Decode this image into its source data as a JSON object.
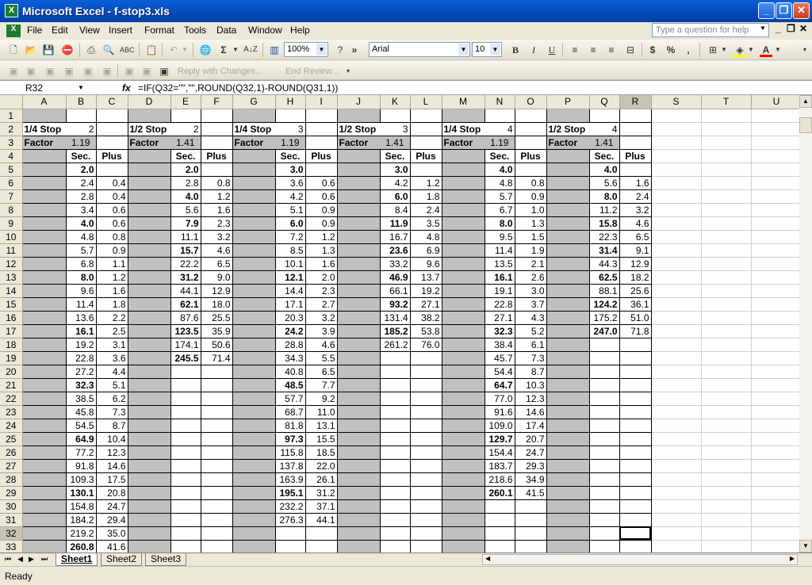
{
  "window": {
    "title": "Microsoft Excel - f-stop3.xls",
    "app_icon": "X",
    "min": "_",
    "restore": "❐",
    "close": "✕"
  },
  "menu": [
    "File",
    "Edit",
    "View",
    "Insert",
    "Format",
    "Tools",
    "Data",
    "Window",
    "Help"
  ],
  "help_placeholder": "Type a question for help",
  "toolbar": {
    "zoom": "100%",
    "font": "Arial",
    "size": "10",
    "bold": "B",
    "italic": "I",
    "underline": "U",
    "reply": "Reply with Changes...",
    "end_review": "End Review..."
  },
  "formula_bar": {
    "name_box": "R32",
    "fx": "fx",
    "formula": "=IF(Q32=\"\",\"\",ROUND(Q32,1)-ROUND(Q31,1))"
  },
  "columns": [
    "A",
    "B",
    "C",
    "D",
    "E",
    "F",
    "G",
    "H",
    "I",
    "J",
    "K",
    "L",
    "M",
    "N",
    "O",
    "P",
    "Q",
    "R",
    "S",
    "T",
    "U"
  ],
  "sheet": {
    "labels": {
      "quarter": "1/4 Stop",
      "half": "1/2 Stop",
      "factor": "Factor",
      "sec": "Sec.",
      "plus": "Plus"
    },
    "groups": [
      {
        "start": "2",
        "factor": "1.19",
        "sec": [
          "2.0",
          "2.4",
          "2.8",
          "3.4",
          "4.0",
          "4.8",
          "5.7",
          "6.8",
          "8.0",
          "9.6",
          "11.4",
          "13.6",
          "16.1",
          "19.2",
          "22.8",
          "27.2",
          "32.3",
          "38.5",
          "45.8",
          "54.5",
          "64.9",
          "77.2",
          "91.8",
          "109.3",
          "130.1",
          "154.8",
          "184.2",
          "219.2",
          "260.8"
        ],
        "plus": [
          "",
          "0.4",
          "0.4",
          "0.6",
          "0.6",
          "0.8",
          "0.9",
          "1.1",
          "1.2",
          "1.6",
          "1.8",
          "2.2",
          "2.5",
          "3.1",
          "3.6",
          "4.4",
          "5.1",
          "6.2",
          "7.3",
          "8.7",
          "10.4",
          "12.3",
          "14.6",
          "17.5",
          "20.8",
          "24.7",
          "29.4",
          "35.0",
          "41.6"
        ]
      },
      {
        "start": "2",
        "factor": "1.41",
        "sec": [
          "2.0",
          "2.8",
          "4.0",
          "5.6",
          "7.9",
          "11.1",
          "15.7",
          "22.2",
          "31.2",
          "44.1",
          "62.1",
          "87.6",
          "123.5",
          "174.1",
          "245.5"
        ],
        "plus": [
          "",
          "0.8",
          "1.2",
          "1.6",
          "2.3",
          "3.2",
          "4.6",
          "6.5",
          "9.0",
          "12.9",
          "18.0",
          "25.5",
          "35.9",
          "50.6",
          "71.4"
        ]
      },
      {
        "start": "3",
        "factor": "1.19",
        "sec": [
          "3.0",
          "3.6",
          "4.2",
          "5.1",
          "6.0",
          "7.2",
          "8.5",
          "10.1",
          "12.1",
          "14.4",
          "17.1",
          "20.3",
          "24.2",
          "28.8",
          "34.3",
          "40.8",
          "48.5",
          "57.7",
          "68.7",
          "81.8",
          "97.3",
          "115.8",
          "137.8",
          "163.9",
          "195.1",
          "232.2",
          "276.3"
        ],
        "plus": [
          "",
          "0.6",
          "0.6",
          "0.9",
          "0.9",
          "1.2",
          "1.3",
          "1.6",
          "2.0",
          "2.3",
          "2.7",
          "3.2",
          "3.9",
          "4.6",
          "5.5",
          "6.5",
          "7.7",
          "9.2",
          "11.0",
          "13.1",
          "15.5",
          "18.5",
          "22.0",
          "26.1",
          "31.2",
          "37.1",
          "44.1"
        ]
      },
      {
        "start": "3",
        "factor": "1.41",
        "sec": [
          "3.0",
          "4.2",
          "6.0",
          "8.4",
          "11.9",
          "16.7",
          "23.6",
          "33.2",
          "46.9",
          "66.1",
          "93.2",
          "131.4",
          "185.2",
          "261.2"
        ],
        "plus": [
          "",
          "1.2",
          "1.8",
          "2.4",
          "3.5",
          "4.8",
          "6.9",
          "9.6",
          "13.7",
          "19.2",
          "27.1",
          "38.2",
          "53.8",
          "76.0"
        ]
      },
      {
        "start": "4",
        "factor": "1.19",
        "sec": [
          "4.0",
          "4.8",
          "5.7",
          "6.7",
          "8.0",
          "9.5",
          "11.4",
          "13.5",
          "16.1",
          "19.1",
          "22.8",
          "27.1",
          "32.3",
          "38.4",
          "45.7",
          "54.4",
          "64.7",
          "77.0",
          "91.6",
          "109.0",
          "129.7",
          "154.4",
          "183.7",
          "218.6",
          "260.1"
        ],
        "plus": [
          "",
          "0.8",
          "0.9",
          "1.0",
          "1.3",
          "1.5",
          "1.9",
          "2.1",
          "2.6",
          "3.0",
          "3.7",
          "4.3",
          "5.2",
          "6.1",
          "7.3",
          "8.7",
          "10.3",
          "12.3",
          "14.6",
          "17.4",
          "20.7",
          "24.7",
          "29.3",
          "34.9",
          "41.5"
        ]
      },
      {
        "start": "4",
        "factor": "1.41",
        "sec": [
          "4.0",
          "5.6",
          "8.0",
          "11.2",
          "15.8",
          "22.3",
          "31.4",
          "44.3",
          "62.5",
          "88.1",
          "124.2",
          "175.2",
          "247.0"
        ],
        "plus": [
          "",
          "1.6",
          "2.4",
          "3.2",
          "4.6",
          "6.5",
          "9.1",
          "12.9",
          "18.2",
          "25.6",
          "36.1",
          "51.0",
          "71.8"
        ]
      }
    ]
  },
  "sheet_tabs": [
    "Sheet1",
    "Sheet2",
    "Sheet3"
  ],
  "status": "Ready"
}
